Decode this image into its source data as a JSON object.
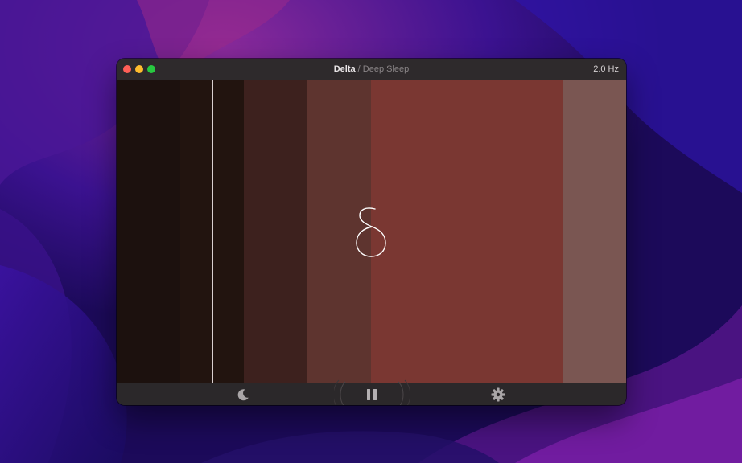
{
  "window": {
    "title_wave": "Delta",
    "title_separator": " / ",
    "title_mode": "Deep Sleep",
    "frequency": "2.0 Hz"
  },
  "traffic_lights": {
    "close": "#ff5f57",
    "minimize": "#febc2e",
    "zoom": "#28c840"
  },
  "visualizer": {
    "symbol": "delta-glyph",
    "symbol_color": "#ffffff",
    "band_colors": [
      "#1c110e",
      "#22140f",
      "#3d211e",
      "#5e342f",
      "#7a3732",
      "#7a5652"
    ],
    "playhead_color": "#d9cfcf"
  },
  "toolbar": {
    "items": [
      {
        "name": "moon-icon",
        "label": "sleep timer"
      },
      {
        "name": "pause-icon",
        "label": "pause"
      },
      {
        "name": "gear-icon",
        "label": "settings"
      }
    ],
    "icon_color": "#9a9698"
  },
  "colors": {
    "wallpaper_base": "#2a0f7a",
    "wallpaper_accent": "#7a1fa8"
  }
}
